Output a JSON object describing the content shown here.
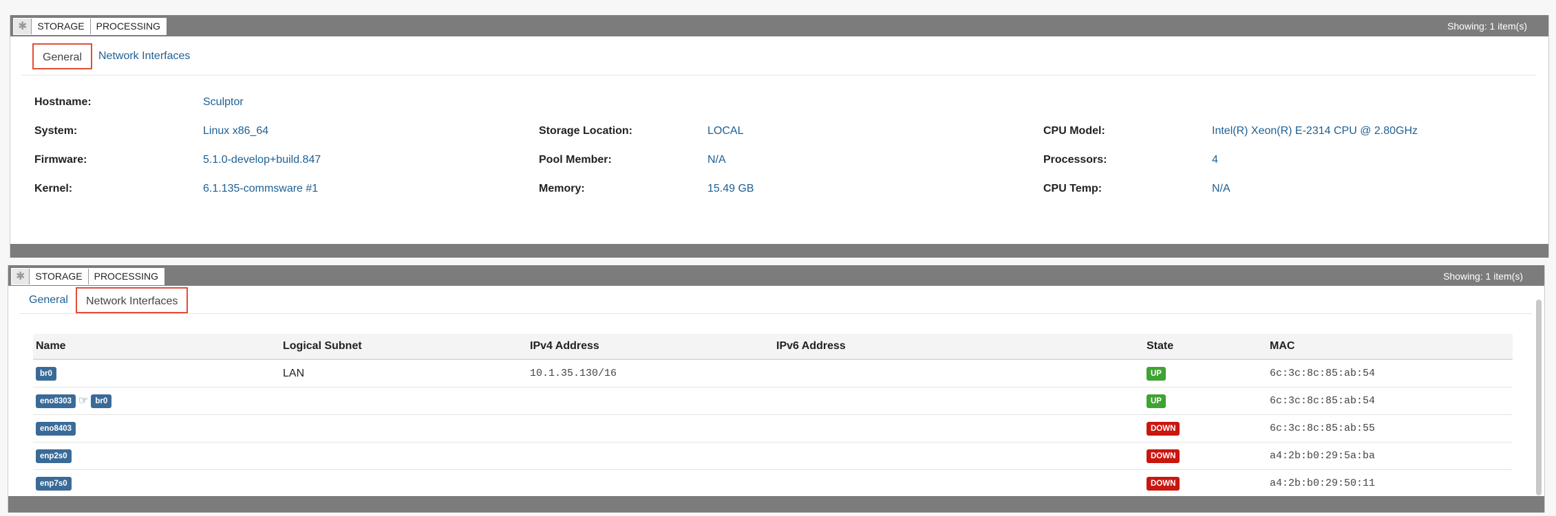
{
  "panel1": {
    "crumb_icon": "✱",
    "crumbs": [
      "STORAGE",
      "PROCESSING"
    ],
    "showing": "Showing: 1 item(s)",
    "tabs": {
      "general": "General",
      "network": "Network Interfaces"
    },
    "fields": {
      "hostname": {
        "label": "Hostname:",
        "value": "Sculptor"
      },
      "system": {
        "label": "System:",
        "value": "Linux x86_64"
      },
      "firmware": {
        "label": "Firmware:",
        "value": "5.1.0-develop+build.847"
      },
      "kernel": {
        "label": "Kernel:",
        "value": "6.1.135-commsware #1"
      },
      "storage_location": {
        "label": "Storage Location:",
        "value": "LOCAL"
      },
      "pool_member": {
        "label": "Pool Member:",
        "value": "N/A"
      },
      "memory": {
        "label": "Memory:",
        "value": "15.49 GB"
      },
      "cpu_model": {
        "label": "CPU Model:",
        "value": "Intel(R) Xeon(R) E-2314 CPU @ 2.80GHz"
      },
      "processors": {
        "label": "Processors:",
        "value": "4"
      },
      "cpu_temp": {
        "label": "CPU Temp:",
        "value": "N/A"
      }
    }
  },
  "panel2": {
    "crumb_icon": "✱",
    "crumbs": [
      "STORAGE",
      "PROCESSING"
    ],
    "showing": "Showing: 1 item(s)",
    "tabs": {
      "general": "General",
      "network": "Network Interfaces"
    },
    "columns": [
      "Name",
      "Logical Subnet",
      "IPv4 Address",
      "IPv6 Address",
      "State",
      "MAC"
    ],
    "rows": [
      {
        "name": "br0",
        "bridge": "",
        "subnet": "LAN",
        "ipv4": "10.1.35.130/16",
        "ipv6": "",
        "state": "UP",
        "mac": "6c:3c:8c:85:ab:54"
      },
      {
        "name": "eno8303",
        "bridge": "br0",
        "subnet": "",
        "ipv4": "",
        "ipv6": "",
        "state": "UP",
        "mac": "6c:3c:8c:85:ab:54"
      },
      {
        "name": "eno8403",
        "bridge": "",
        "subnet": "",
        "ipv4": "",
        "ipv6": "",
        "state": "DOWN",
        "mac": "6c:3c:8c:85:ab:55"
      },
      {
        "name": "enp2s0",
        "bridge": "",
        "subnet": "",
        "ipv4": "",
        "ipv6": "",
        "state": "DOWN",
        "mac": "a4:2b:b0:29:5a:ba"
      },
      {
        "name": "enp7s0",
        "bridge": "",
        "subnet": "",
        "ipv4": "",
        "ipv6": "",
        "state": "DOWN",
        "mac": "a4:2b:b0:29:50:11"
      }
    ]
  },
  "colors": {
    "titlebar": "#7c7c7c",
    "link": "#1d5f92",
    "active_tab_border": "#e24c36",
    "state_up": "#3fa333",
    "state_down": "#c9160f",
    "name_pill": "#3a6b98"
  },
  "icons": {
    "crumb": "asterisk-icon",
    "bridge": "pointing-hand-icon"
  }
}
